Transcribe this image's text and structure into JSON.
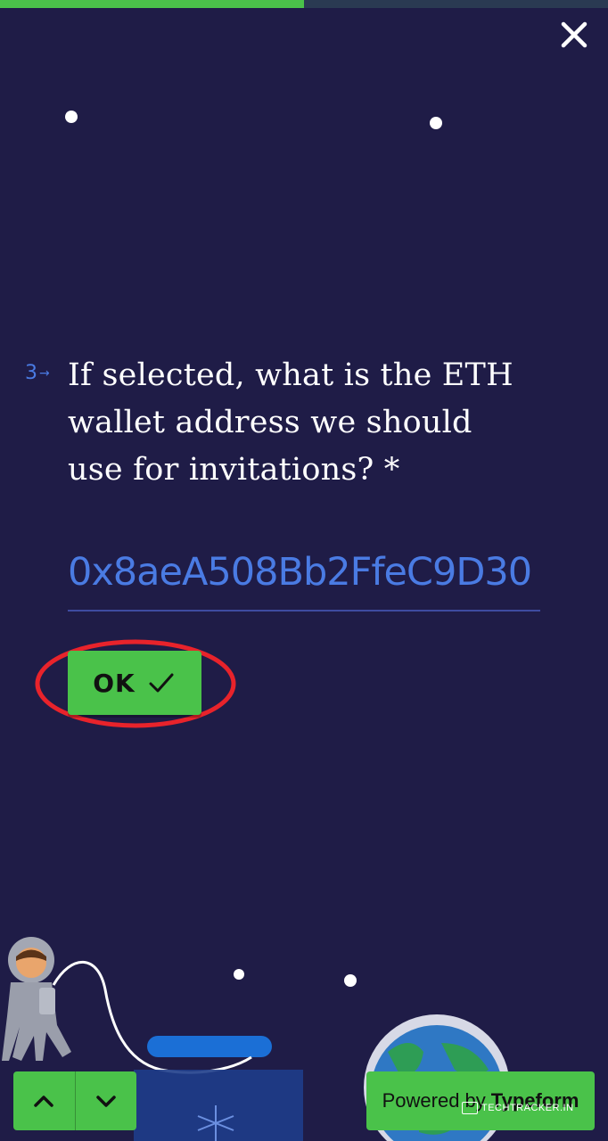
{
  "progress": {
    "fraction": 0.5
  },
  "colors": {
    "background": "#1f1c47",
    "accent_green": "#4ac24a",
    "accent_blue": "#4a7be3",
    "highlight_red": "#e8232b"
  },
  "close": {
    "icon": "close-icon"
  },
  "question": {
    "number": "3",
    "arrow": "→",
    "text": "If selected, what is the ETH wallet address we should use for invitations? *"
  },
  "answer": {
    "value": "0x8aeA508Bb2FfeC9D30"
  },
  "ok_button": {
    "label": "OK",
    "icon": "check-icon"
  },
  "navigation": {
    "up_icon": "chevron-up-icon",
    "down_icon": "chevron-down-icon"
  },
  "footer": {
    "powered_prefix": "Powered by",
    "brand": "Typeform"
  },
  "watermark": {
    "text": "TECHTRACKER.IN"
  }
}
